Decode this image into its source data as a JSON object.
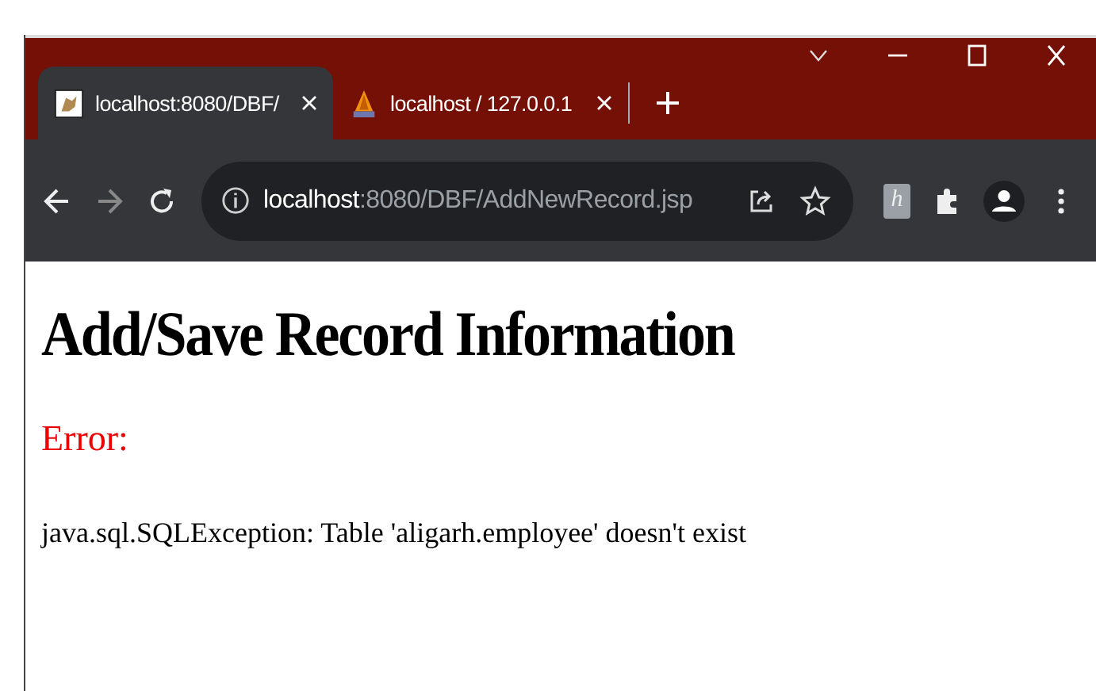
{
  "tabs": [
    {
      "title": "localhost:8080/DBF/",
      "selected": true
    },
    {
      "title": "localhost / 127.0.0.1",
      "selected": false
    }
  ],
  "address_bar": {
    "host": "localhost",
    "path": ":8080/DBF/AddNewRecord.jsp"
  },
  "extension_badge": "h",
  "page": {
    "heading": "Add/Save Record Information",
    "error_label": "Error:",
    "message": "java.sql.SQLException: Table 'aligarh.employee' doesn't exist"
  }
}
